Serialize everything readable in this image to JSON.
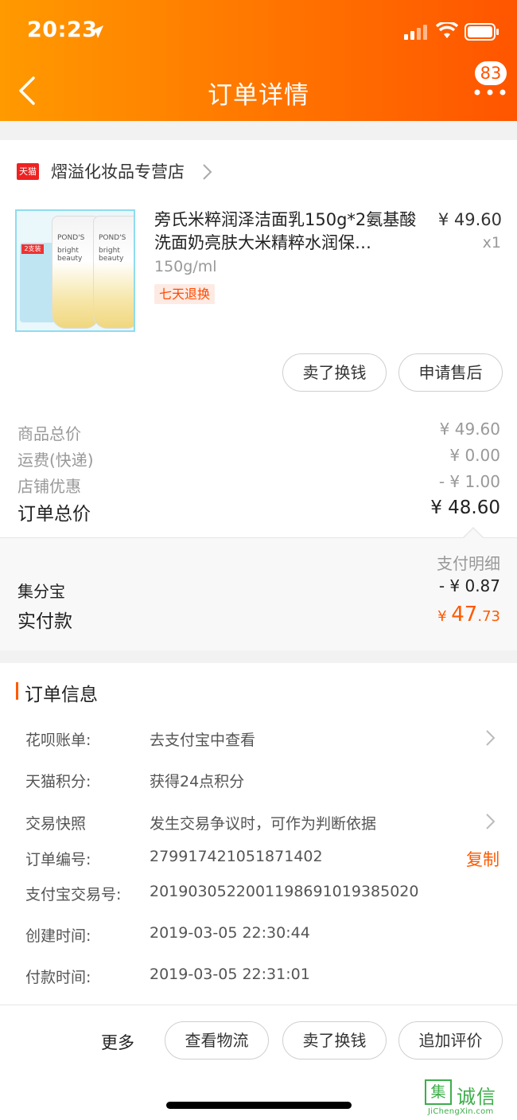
{
  "status_bar": {
    "time": "20:23"
  },
  "nav": {
    "title": "订单详情",
    "badge": "83"
  },
  "store": {
    "logo": "天猫",
    "name": "熠溢化妆品专营店"
  },
  "product": {
    "title": "旁氏米粹润泽洁面乳150g*2氨基酸洗面奶亮肤大米精粹水润保…",
    "price": "¥ 49.60",
    "qty": "x1",
    "spec": "150g/ml",
    "tag": "七天退换",
    "image_text": {
      "pack_tag": "2支装",
      "brand": "POND'S",
      "sub": "bright beauty"
    },
    "buttons": {
      "sell": "卖了换钱",
      "aftersale": "申请售后"
    }
  },
  "summary": {
    "rows": [
      {
        "label": "商品总价",
        "value": "¥ 49.60"
      },
      {
        "label": "运费(快递)",
        "value": "¥ 0.00"
      },
      {
        "label": "店铺优惠",
        "value": "- ¥ 1.00"
      }
    ],
    "total_label": "订单总价",
    "total_value": "¥ 48.60"
  },
  "payment": {
    "detail_link": "支付明细",
    "jfb_label": "集分宝",
    "jfb_value": "- ¥ 0.87",
    "paid_label": "实付款",
    "paid_symbol": "¥ ",
    "paid_int": "47",
    "paid_dec": ".73"
  },
  "order_info": {
    "title": "订单信息",
    "rows": [
      {
        "label": "花呗账单:",
        "value": "去支付宝中查看"
      },
      {
        "label": "天猫积分:",
        "value": "获得24点积分"
      },
      {
        "label": "交易快照",
        "value": "发生交易争议时，可作为判断依据"
      },
      {
        "label": "订单编号:",
        "value": "279917421051871402"
      },
      {
        "label": "支付宝交易号:",
        "value": "2019030522001198691019385020"
      },
      {
        "label": "创建时间:",
        "value": "2019-03-05 22:30:44"
      },
      {
        "label": "付款时间:",
        "value": "2019-03-05 22:31:01"
      }
    ],
    "copy": "复制"
  },
  "bottom": {
    "more": "更多",
    "logistics": "查看物流",
    "sell": "卖了换钱",
    "review": "追加评价"
  },
  "watermark": {
    "mark": "集",
    "text": "诚信",
    "sub": "JiChengXin.com"
  }
}
